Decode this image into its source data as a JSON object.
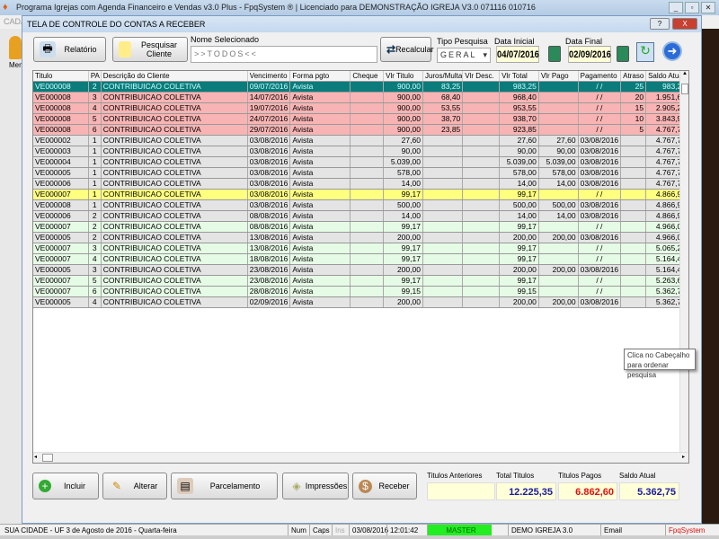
{
  "app": {
    "title": "Programa Igrejas com Agenda Financeiro e Vendas v3.0 Plus - FpqSystem ® | Licenciado para  DEMONSTRAÇÃO IGREJA V3.0 071116 010716",
    "menu_partial": "CADA",
    "left_label": "Men"
  },
  "dialog": {
    "title": "TELA DE CONTROLE DO CONTAS A RECEBER",
    "help": "?",
    "close": "X"
  },
  "toolbar": {
    "relatorio": "Relatório",
    "pesquisar": "Pesquisar Cliente",
    "nome_label": "Nome Selecionado",
    "nome_value": ">>TODOS<<",
    "recalcular": "Recalcular",
    "tipo_label": "Tipo  Pesquisa",
    "tipo_value": "GERAL",
    "data_inicial_label": "Data Inicial",
    "data_inicial": "04/07/2016",
    "data_final_label": "Data Final",
    "data_final": "02/09/2016"
  },
  "columns": [
    "Titulo",
    "PA",
    "Descrição do Cliente",
    "Vencimento",
    "Forma pgto",
    "Cheque",
    "Vlr Titulo",
    "Juros/Multa",
    "Vlr Desc.",
    "Vlr Total",
    "Vlr Pago",
    "Pagamento",
    "Atraso",
    "Saldo Atual"
  ],
  "rows": [
    [
      "VE000008",
      "2",
      "CONTRIBUICAO COLETIVA",
      "09/07/2016",
      "Avista",
      "",
      "900,00",
      "83,25",
      "",
      "983,25",
      "",
      " / /",
      "25",
      "983,25",
      "sel"
    ],
    [
      "VE000008",
      "3",
      "CONTRIBUICAO COLETIVA",
      "14/07/2016",
      "Avista",
      "",
      "900,00",
      "68,40",
      "",
      "968,40",
      "",
      " / /",
      "20",
      "1.951,65",
      "late"
    ],
    [
      "VE000008",
      "4",
      "CONTRIBUICAO COLETIVA",
      "19/07/2016",
      "Avista",
      "",
      "900,00",
      "53,55",
      "",
      "953,55",
      "",
      " / /",
      "15",
      "2.905,20",
      "late"
    ],
    [
      "VE000008",
      "5",
      "CONTRIBUICAO COLETIVA",
      "24/07/2016",
      "Avista",
      "",
      "900,00",
      "38,70",
      "",
      "938,70",
      "",
      " / /",
      "10",
      "3.843,90",
      "late"
    ],
    [
      "VE000008",
      "6",
      "CONTRIBUICAO COLETIVA",
      "29/07/2016",
      "Avista",
      "",
      "900,00",
      "23,85",
      "",
      "923,85",
      "",
      " / /",
      "5",
      "4.767,75",
      "late"
    ],
    [
      "VE000002",
      "1",
      "CONTRIBUICAO COLETIVA",
      "03/08/2016",
      "Avista",
      "",
      "27,60",
      "",
      "",
      "27,60",
      "27,60",
      "03/08/2016",
      "",
      "4.767,75",
      "paid"
    ],
    [
      "VE000003",
      "1",
      "CONTRIBUICAO COLETIVA",
      "03/08/2016",
      "Avista",
      "",
      "90,00",
      "",
      "",
      "90,00",
      "90,00",
      "03/08/2016",
      "",
      "4.767,75",
      "paid"
    ],
    [
      "VE000004",
      "1",
      "CONTRIBUICAO COLETIVA",
      "03/08/2016",
      "Avista",
      "",
      "5.039,00",
      "",
      "",
      "5.039,00",
      "5.039,00",
      "03/08/2016",
      "",
      "4.767,75",
      "paid"
    ],
    [
      "VE000005",
      "1",
      "CONTRIBUICAO COLETIVA",
      "03/08/2016",
      "Avista",
      "",
      "578,00",
      "",
      "",
      "578,00",
      "578,00",
      "03/08/2016",
      "",
      "4.767,75",
      "paid"
    ],
    [
      "VE000006",
      "1",
      "CONTRIBUICAO COLETIVA",
      "03/08/2016",
      "Avista",
      "",
      "14,00",
      "",
      "",
      "14,00",
      "14,00",
      "03/08/2016",
      "",
      "4.767,75",
      "paid"
    ],
    [
      "VE000007",
      "1",
      "CONTRIBUICAO COLETIVA",
      "03/08/2016",
      "Avista",
      "",
      "99,17",
      "",
      "",
      "99,17",
      "",
      " / /",
      "",
      "4.866,92",
      "today"
    ],
    [
      "VE000008",
      "1",
      "CONTRIBUICAO COLETIVA",
      "03/08/2016",
      "Avista",
      "",
      "500,00",
      "",
      "",
      "500,00",
      "500,00",
      "03/08/2016",
      "",
      "4.866,92",
      "paid"
    ],
    [
      "VE000006",
      "2",
      "CONTRIBUICAO COLETIVA",
      "08/08/2016",
      "Avista",
      "",
      "14,00",
      "",
      "",
      "14,00",
      "14,00",
      "03/08/2016",
      "",
      "4.866,92",
      "paid"
    ],
    [
      "VE000007",
      "2",
      "CONTRIBUICAO COLETIVA",
      "08/08/2016",
      "Avista",
      "",
      "99,17",
      "",
      "",
      "99,17",
      "",
      " / /",
      "",
      "4.966,09",
      "open"
    ],
    [
      "VE000005",
      "2",
      "CONTRIBUICAO COLETIVA",
      "13/08/2016",
      "Avista",
      "",
      "200,00",
      "",
      "",
      "200,00",
      "200,00",
      "03/08/2016",
      "",
      "4.966,09",
      "paid"
    ],
    [
      "VE000007",
      "3",
      "CONTRIBUICAO COLETIVA",
      "13/08/2016",
      "Avista",
      "",
      "99,17",
      "",
      "",
      "99,17",
      "",
      " / /",
      "",
      "5.065,26",
      "open"
    ],
    [
      "VE000007",
      "4",
      "CONTRIBUICAO COLETIVA",
      "18/08/2016",
      "Avista",
      "",
      "99,17",
      "",
      "",
      "99,17",
      "",
      " / /",
      "",
      "5.164,43",
      "open"
    ],
    [
      "VE000005",
      "3",
      "CONTRIBUICAO COLETIVA",
      "23/08/2016",
      "Avista",
      "",
      "200,00",
      "",
      "",
      "200,00",
      "200,00",
      "03/08/2016",
      "",
      "5.164,43",
      "paid"
    ],
    [
      "VE000007",
      "5",
      "CONTRIBUICAO COLETIVA",
      "23/08/2016",
      "Avista",
      "",
      "99,17",
      "",
      "",
      "99,17",
      "",
      " / /",
      "",
      "5.263,60",
      "open"
    ],
    [
      "VE000007",
      "6",
      "CONTRIBUICAO COLETIVA",
      "28/08/2016",
      "Avista",
      "",
      "99,15",
      "",
      "",
      "99,15",
      "",
      " / /",
      "",
      "5.362,75",
      "open"
    ],
    [
      "VE000005",
      "4",
      "CONTRIBUICAO COLETIVA",
      "02/09/2016",
      "Avista",
      "",
      "200,00",
      "",
      "",
      "200,00",
      "200,00",
      "03/08/2016",
      "",
      "5.362,75",
      "paid"
    ]
  ],
  "tooltip": {
    "line1": "Clica no Cabeçalho",
    "line2": "para ordenar pesquisa"
  },
  "actions": {
    "incluir": "Incluir",
    "alterar": "Alterar",
    "parcelamento": "Parcelamento",
    "impressoes": "Impressões",
    "receber": "Receber"
  },
  "totals": {
    "anteriores_label": "Titulos Anteriores",
    "anteriores": "",
    "total_label": "Total Titulos",
    "total": "12.225,35",
    "pagos_label": "Titulos Pagos",
    "pagos": "6.862,60",
    "saldo_label": "Saldo Atual",
    "saldo": "5.362,75"
  },
  "colors": {
    "total": "#1a1aa0",
    "pagos": "#e01010",
    "saldo": "#1a1aa0",
    "selected": "#0b7b7b",
    "late": "#f8b4b4",
    "today": "#ffff80",
    "open": "#e6fbe6",
    "paid": "#e4e4e4"
  },
  "statusbar": {
    "city": "SUA CIDADE - UF  3 de Agosto de 2016 - Quarta-feira",
    "num": "Num",
    "caps": "Caps",
    "ins": "Ins",
    "date": "03/08/2016",
    "time": "12:01:42",
    "user": "MASTER",
    "company": "DEMO IGREJA 3.0",
    "email": "Email",
    "brand": "FpqSystem"
  }
}
